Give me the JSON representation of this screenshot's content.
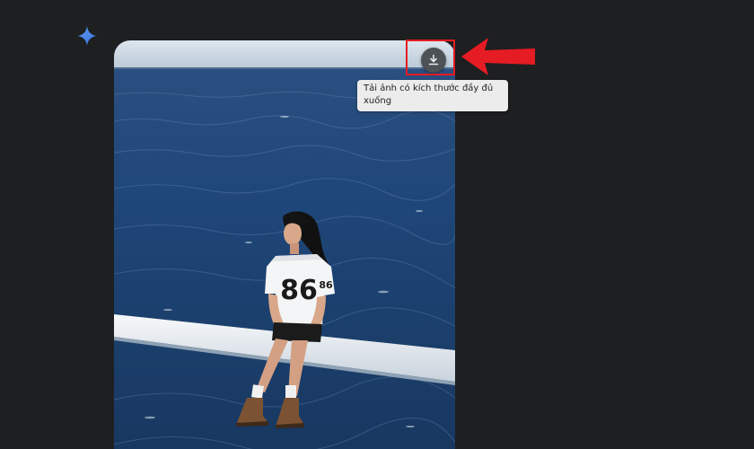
{
  "response": {
    "sparkle_icon": "sparkle-icon",
    "accent_color": "#4a86e8"
  },
  "generated_image": {
    "jersey_number": "86"
  },
  "download": {
    "icon": "download-icon",
    "tooltip": "Tải ảnh có kích thước đầy đủ xuống"
  },
  "annotation": {
    "color": "#e51c23"
  }
}
